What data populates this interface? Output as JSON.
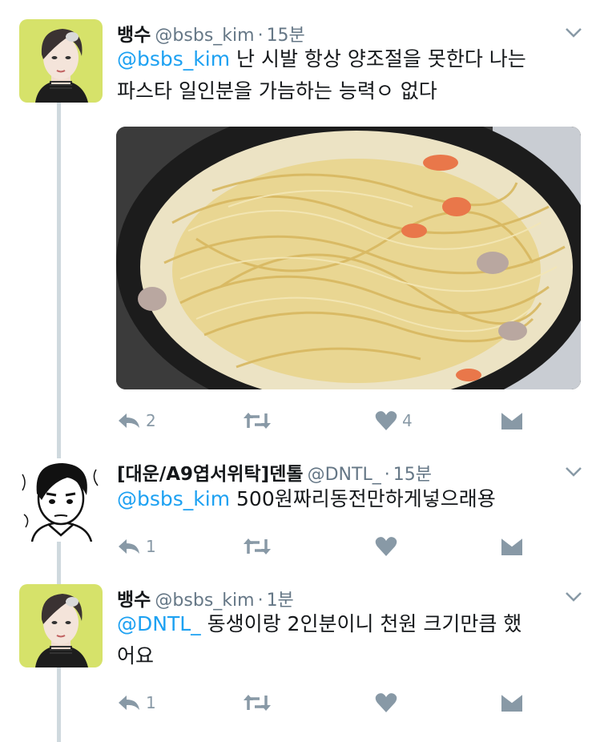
{
  "tweets": [
    {
      "name": "뱅수",
      "handle": "@bsbs_kim",
      "time": "15분",
      "mention": "@bsbs_kim",
      "line1": " 난 시발 항상 양조절을 못한다 나는",
      "line2": "파스타 일인분을 가늠하는 능력ㅇ 없다",
      "reply_count": "2",
      "retweet_count": "",
      "like_count": "4",
      "media_icon": "spaghetti-photo"
    },
    {
      "name": "[대운/A9엽서위탁]덴톨",
      "handle": "@DNTL_",
      "time": "15분",
      "mention": "@bsbs_kim",
      "line1": " 500원짜리동전만하게넣으래용",
      "reply_count": "1",
      "retweet_count": "",
      "like_count": ""
    },
    {
      "name": "뱅수",
      "handle": "@bsbs_kim",
      "time": "1분",
      "mention": "@DNTL_",
      "line1": " 동생이랑 2인분이니 천원 크기만큼 했",
      "line2": "어요",
      "reply_count": "1",
      "retweet_count": "",
      "like_count": ""
    }
  ],
  "colors": {
    "accent": "#1da1f2",
    "icon_gray": "#8899a6",
    "text": "#14171a",
    "secondary": "#657786",
    "thread_line": "#cfd9de"
  },
  "icons": [
    "reply-icon",
    "retweet-icon",
    "heart-icon",
    "dm-icon",
    "chevron-down-icon"
  ]
}
